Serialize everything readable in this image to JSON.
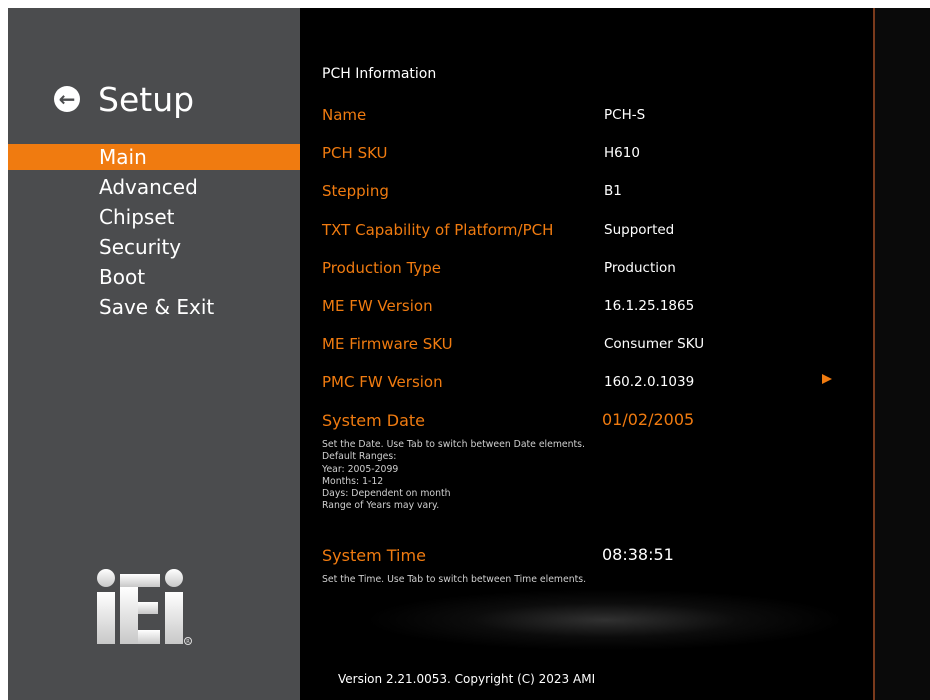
{
  "sidebar": {
    "title": "Setup",
    "back_icon": "back-arrow-icon",
    "items": [
      {
        "label": "Main",
        "active": true
      },
      {
        "label": "Advanced"
      },
      {
        "label": "Chipset"
      },
      {
        "label": "Security"
      },
      {
        "label": "Boot"
      },
      {
        "label": "Save & Exit"
      }
    ],
    "logo": "iEi",
    "logo_mark": "®"
  },
  "main": {
    "section_title": "PCH Information",
    "rows": [
      {
        "label": "Name",
        "value": "PCH-S"
      },
      {
        "label": "PCH SKU",
        "value": "H610"
      },
      {
        "label": "Stepping",
        "value": "B1"
      },
      {
        "label": "TXT Capability of Platform/PCH",
        "value": "Supported"
      },
      {
        "label": "Production Type",
        "value": "Production"
      },
      {
        "label": "ME FW Version",
        "value": "16.1.25.1865"
      },
      {
        "label": "ME Firmware SKU",
        "value": "Consumer SKU"
      },
      {
        "label": "PMC FW Version",
        "value": "160.2.0.1039"
      }
    ],
    "system_date": {
      "label": "System Date",
      "value": "01/02/2005",
      "help": [
        "Set the Date. Use Tab to switch between Date elements.",
        "Default Ranges:",
        "Year: 2005-2099",
        "Months: 1-12",
        "Days: Dependent on month",
        "Range of Years may vary."
      ]
    },
    "system_time": {
      "label": "System Time",
      "value": "08:38:51",
      "help": "Set the Time. Use Tab to switch between Time elements."
    },
    "footer": "Version 2.21.0053. Copyright (C) 2023 AMI"
  },
  "colors": {
    "accent": "#f07b10",
    "sidebar_bg": "#4b4c4e",
    "content_bg": "#000000"
  }
}
